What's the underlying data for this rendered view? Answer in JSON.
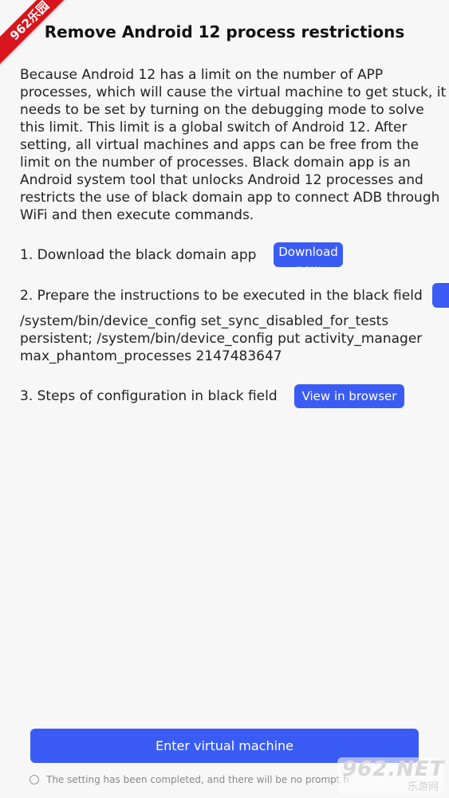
{
  "watermark": {
    "ribbon": "962乐园",
    "logo": "962.NET",
    "subtitle": "乐游网"
  },
  "page": {
    "title": "Remove Android 12 process restrictions",
    "description": "Because Android 12 has a limit on the number of APP processes, which will cause the virtual machine to get stuck, it needs to be set by turning on the debugging mode to solve this limit. This limit is a global switch of Android 12. After setting, all virtual machines and apps can be free from the limit on the number of processes. Black domain app is an Android system tool that unlocks Android 12 processes and restricts the use of black domain app to connect ADB through WiFi and then execute commands."
  },
  "steps": {
    "step1": {
      "text": "1. Download the black domain app",
      "button": "Download now"
    },
    "step2": {
      "text": "2. Prepare the instructions to be executed in the black field",
      "command": "/system/bin/device_config set_sync_disabled_for_tests persistent; /system/bin/device_config put activity_manager max_phantom_processes 2147483647"
    },
    "step3": {
      "text": "3. Steps of configuration in black field",
      "button": "View in browser"
    }
  },
  "footer": {
    "enter_button": "Enter virtual machine",
    "prompt_text": "The setting has been completed, and there will be no prompt for"
  },
  "colors": {
    "accent": "#3a5cf5",
    "ribbon": "#d8141c",
    "background": "#f7f7f7"
  }
}
